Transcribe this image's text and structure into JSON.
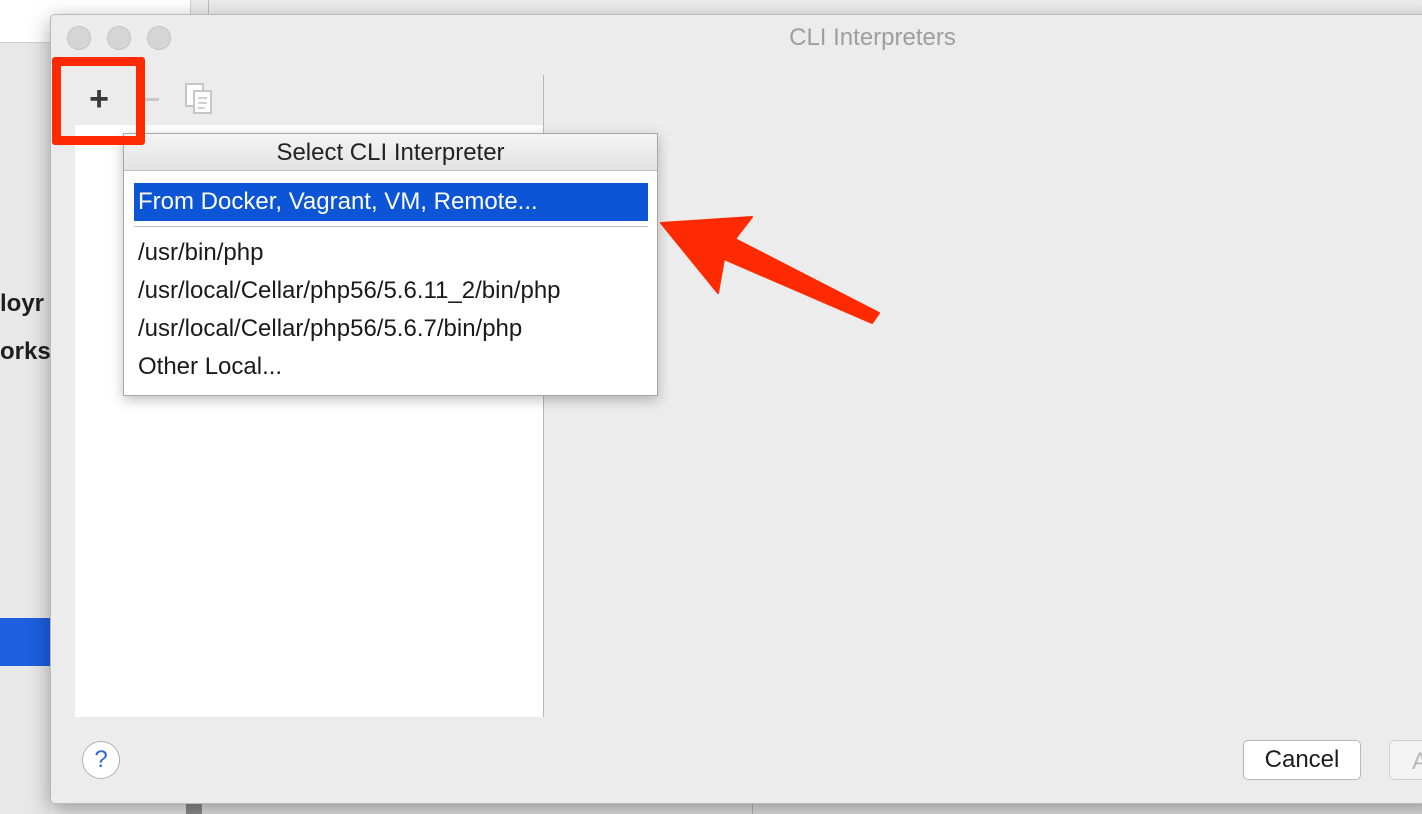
{
  "background": {
    "cut_text_1": "loyr",
    "cut_text_2": "orks"
  },
  "dialog": {
    "title": "CLI Interpreters",
    "toolbar": {
      "add_label": "+",
      "remove_label": "−"
    },
    "help_label": "?",
    "cancel_label": "Cancel",
    "apply_label": "A"
  },
  "popup": {
    "header": "Select CLI Interpreter",
    "items": [
      {
        "label": "From Docker, Vagrant, VM, Remote...",
        "selected": true
      },
      {
        "label": "/usr/bin/php"
      },
      {
        "label": "/usr/local/Cellar/php56/5.6.11_2/bin/php"
      },
      {
        "label": "/usr/local/Cellar/php56/5.6.7/bin/php"
      },
      {
        "label": "Other Local..."
      }
    ]
  },
  "colors": {
    "selection": "#0c55d6",
    "annotation": "#ff2a00"
  }
}
